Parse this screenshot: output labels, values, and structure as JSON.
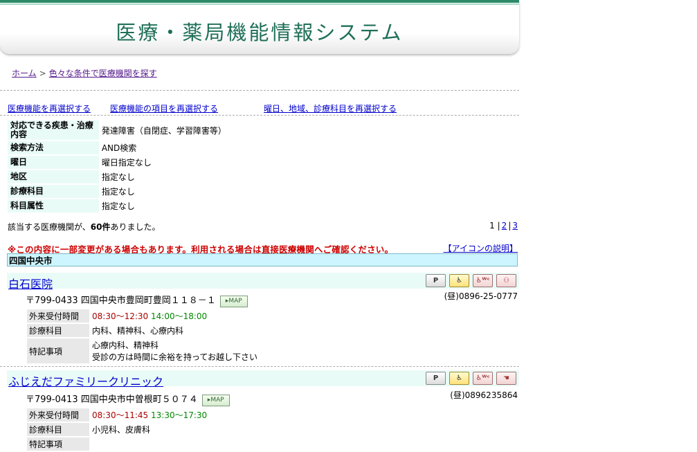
{
  "header": {
    "title": "医療・薬局機能情報システム"
  },
  "breadcrumb": {
    "home": "ホーム",
    "separator": ">",
    "current": "色々な条件で医療機関を探す"
  },
  "reselect": {
    "function": "医療機能を再選択する",
    "items": "医療機能の項目を再選択する",
    "weekday": "曜日、地域、診療科目を再選択する"
  },
  "conditions": [
    {
      "label": "対応できる疾患・治療内容",
      "value": "発達障害（自閉症、学習障害等）"
    },
    {
      "label": "検索方法",
      "value": "AND検索"
    },
    {
      "label": "曜日",
      "value": "曜日指定なし"
    },
    {
      "label": "地区",
      "value": "指定なし"
    },
    {
      "label": "診療科目",
      "value": "指定なし"
    },
    {
      "label": "科目属性",
      "value": "指定なし"
    }
  ],
  "result": {
    "prefix": "該当する医療機関が、",
    "count": "60件",
    "suffix": "ありました。"
  },
  "pager": {
    "current": "1",
    "sep": "|",
    "page2": "2",
    "page3": "3"
  },
  "notice": "※この内容に一部変更がある場合もあります。利用される場合は直接医療機関へご確認ください。",
  "icon_help": "【アイコンの説明】",
  "region": "四国中央市",
  "map_label": "MAP",
  "labels": {
    "hours": "外来受付時間",
    "dept": "診療科目",
    "notes": "特記事項"
  },
  "clinics": [
    {
      "name": "白石医院",
      "address": "〒799-0433 四国中央市豊岡町豊岡１１８－１",
      "tel": "(昼)0896-25-0777",
      "hours_am": "08:30〜12:30",
      "hours_pm": "14:00〜18:00",
      "dept": "内科、精神科、心療内科",
      "notes1": "心療内科、精神科",
      "notes2": "受診の方は時間に余裕を持ってお越し下さい",
      "badges": [
        "parking-icon",
        "wheelchair-icon",
        "accessible-toilet-icon",
        "family-icon"
      ]
    },
    {
      "name": "ふじえだファミリークリニック",
      "address": "〒799-0413 四国中央市中曽根町５０７４",
      "tel": "(昼)0896235864",
      "hours_am": "08:30〜11:45",
      "hours_pm": "13:30〜17:30",
      "dept": "小児科、皮膚科",
      "notes1": "",
      "notes2": "",
      "badges": [
        "parking-icon",
        "wheelchair-icon",
        "accessible-toilet-icon",
        "hand-icon"
      ]
    }
  ]
}
